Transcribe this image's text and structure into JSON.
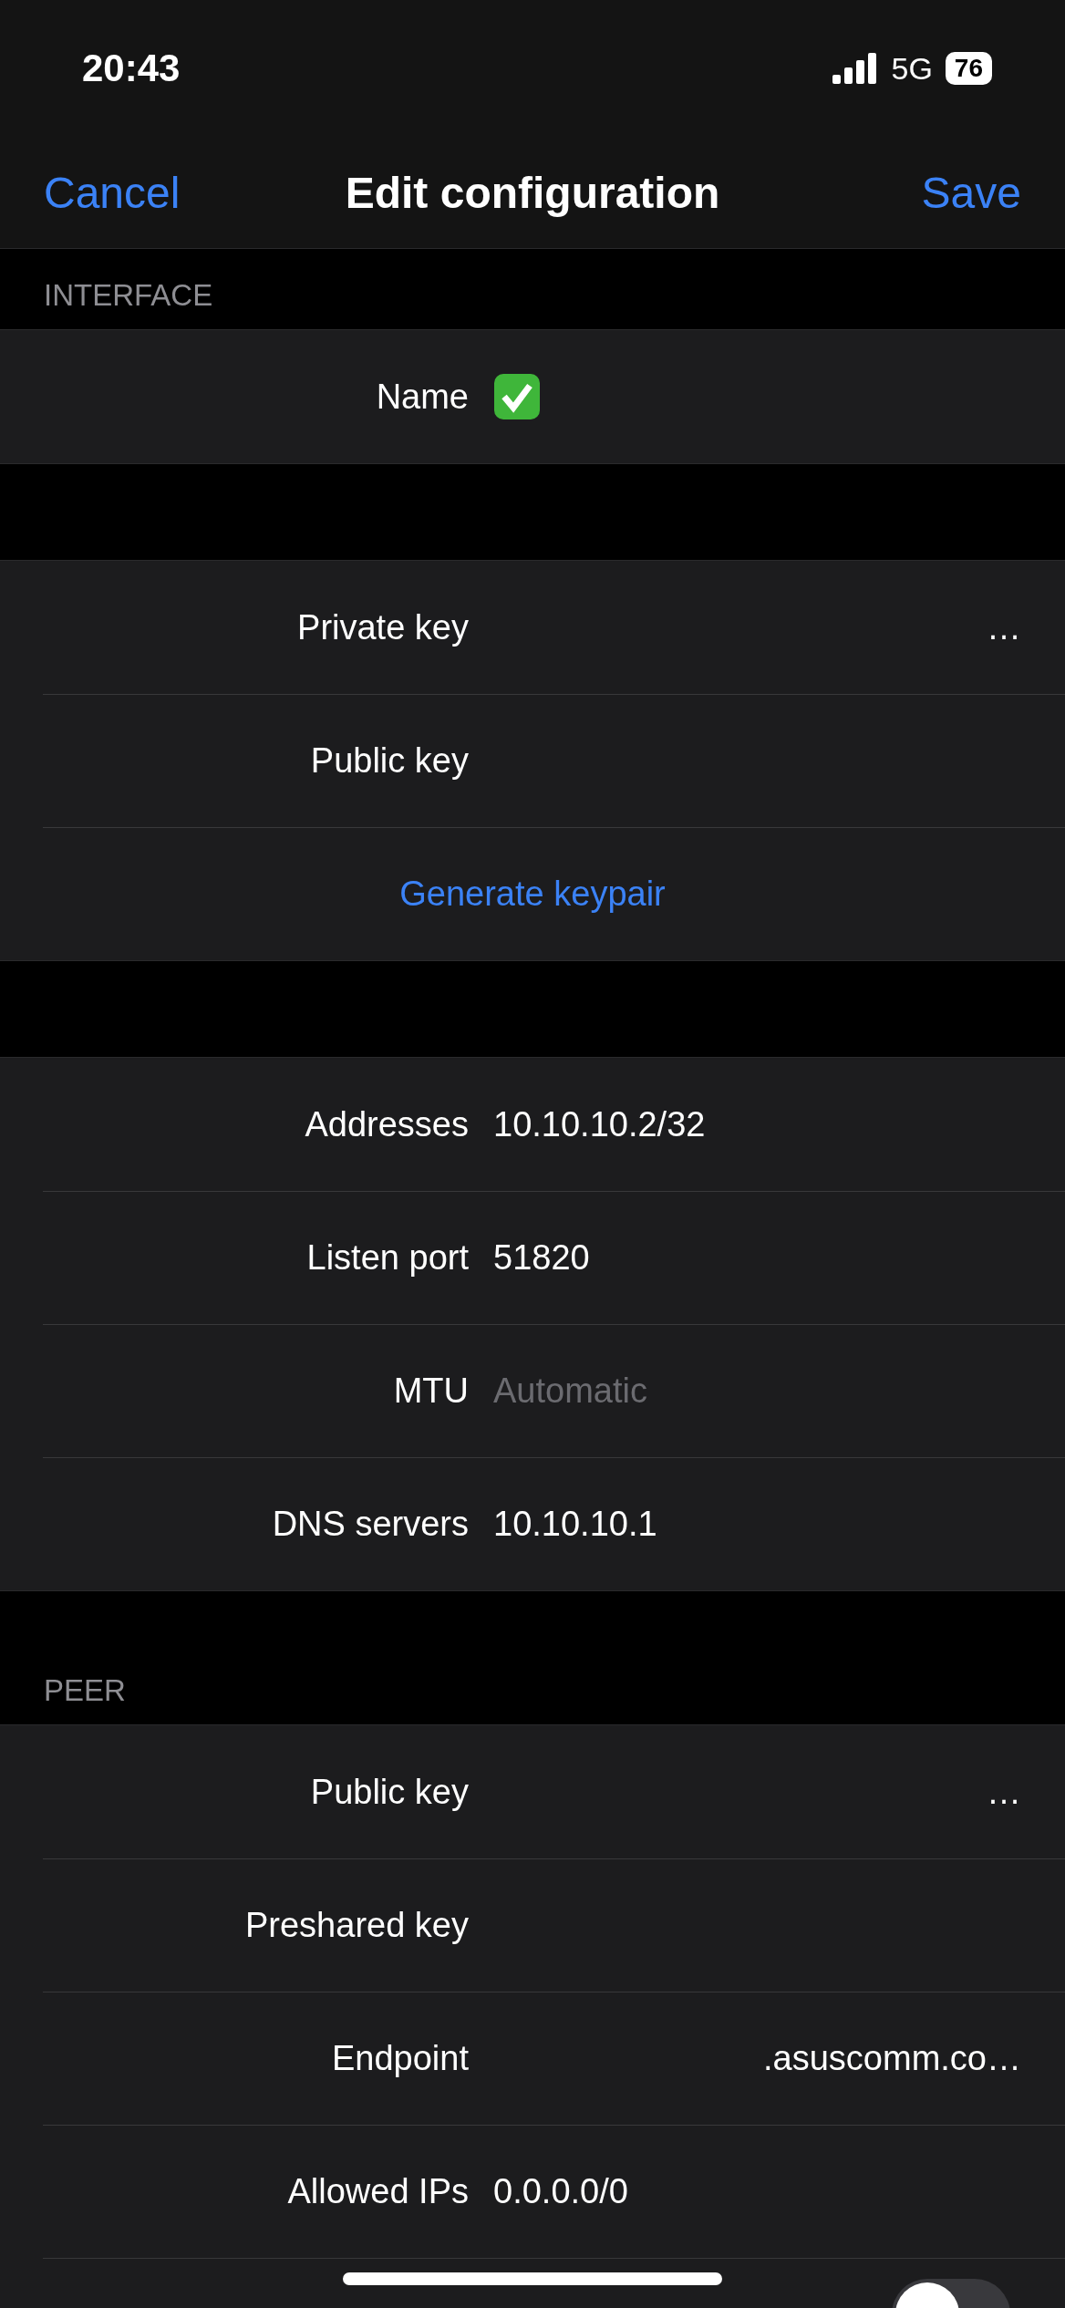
{
  "status_bar": {
    "time": "20:43",
    "network": "5G",
    "battery": "76"
  },
  "nav": {
    "cancel": "Cancel",
    "title": "Edit configuration",
    "save": "Save"
  },
  "sections": [
    {
      "header": "INTERFACE",
      "rows": [
        {
          "kind": "field",
          "label": "Name",
          "icon": true
        }
      ]
    },
    {
      "rows": [
        {
          "kind": "field",
          "label": "Private key",
          "value": "…"
        },
        {
          "kind": "field",
          "label": "Public key"
        },
        {
          "kind": "action",
          "label": "Generate keypair"
        }
      ]
    },
    {
      "rows": [
        {
          "kind": "field",
          "label": "Addresses",
          "value": "10.10.10.2/32"
        },
        {
          "kind": "field",
          "label": "Listen port",
          "value": "51820"
        },
        {
          "kind": "field",
          "label": "MTU",
          "placeholder": "Automatic"
        },
        {
          "kind": "field",
          "label": "DNS servers",
          "value": "10.10.10.1"
        }
      ]
    },
    {
      "header": "PEER",
      "rows": [
        {
          "kind": "field",
          "label": "Public key",
          "value": "…"
        },
        {
          "kind": "field",
          "label": "Preshared key"
        },
        {
          "kind": "field",
          "label": "Endpoint",
          "value": ".asuscomm.co…"
        },
        {
          "kind": "field",
          "label": "Allowed IPs",
          "value": "0.0.0.0/0"
        },
        {
          "kind": "toggle",
          "on": false
        }
      ]
    }
  ]
}
